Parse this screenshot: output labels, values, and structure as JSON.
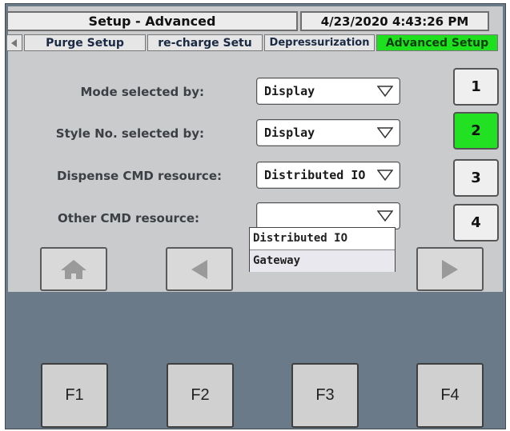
{
  "header": {
    "title": "Setup - Advanced",
    "datetime": "4/23/2020 4:43:26 PM"
  },
  "tabs": [
    {
      "label": "Purge Setup",
      "active": false
    },
    {
      "label": "re-charge Setu",
      "active": false
    },
    {
      "label": "Depressurization",
      "active": false
    },
    {
      "label": "Advanced Setup",
      "active": true
    }
  ],
  "form": {
    "rows": [
      {
        "label": "Mode selected by:",
        "value": "Display"
      },
      {
        "label": "Style No. selected by:",
        "value": "Display"
      },
      {
        "label": "Dispense CMD resource:",
        "value": "Distributed IO"
      },
      {
        "label": "Other CMD resource:",
        "value": ""
      }
    ],
    "open_dropdown_options": [
      "Distributed IO",
      "Gateway"
    ],
    "highlighted_option": "Gateway"
  },
  "side_buttons": [
    {
      "label": "1",
      "active": false
    },
    {
      "label": "2",
      "active": true
    },
    {
      "label": "3",
      "active": false
    },
    {
      "label": "4",
      "active": false
    }
  ],
  "nav_buttons": {
    "home_icon": "home-icon",
    "back_icon": "left-triangle-icon",
    "forward_icon": "right-triangle-icon"
  },
  "function_keys": [
    "F1",
    "F2",
    "F3",
    "F4"
  ],
  "colors": {
    "active_green": "#1fe01f",
    "screen_bg": "#c9cbcd",
    "bezel": "#6b7a88"
  }
}
